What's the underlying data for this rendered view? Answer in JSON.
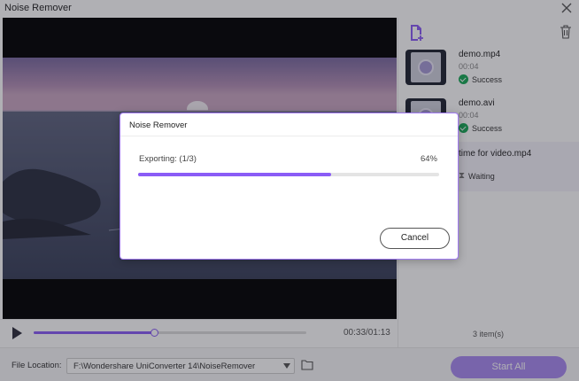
{
  "window": {
    "title": "Noise Remover"
  },
  "player": {
    "time": "00:33/01:13",
    "progress": 0.44
  },
  "files": [
    {
      "name": "demo.mp4",
      "duration": "00:04",
      "status": "Success"
    },
    {
      "name": "demo.avi",
      "duration": "00:04",
      "status": "Success"
    },
    {
      "name": "time for video.mp4",
      "duration": "",
      "status": "Waiting"
    }
  ],
  "list": {
    "count": "3 item(s)"
  },
  "footer": {
    "location_label": "File Location:",
    "location_value": "F:\\Wondershare UniConverter 14\\NoiseRemover",
    "start_all": "Start All"
  },
  "dialog": {
    "title": "Noise Remover",
    "status": "Exporting: (1/3)",
    "percent_text": "64%",
    "progress": 0.64,
    "cancel": "Cancel"
  },
  "colors": {
    "accent": "#8a5cf6",
    "success": "#18a957"
  },
  "icons": [
    "close-icon",
    "play-icon",
    "add-file-icon",
    "trash-icon",
    "check-circle-icon",
    "hourglass-icon",
    "chevron-down-icon",
    "folder-icon"
  ]
}
